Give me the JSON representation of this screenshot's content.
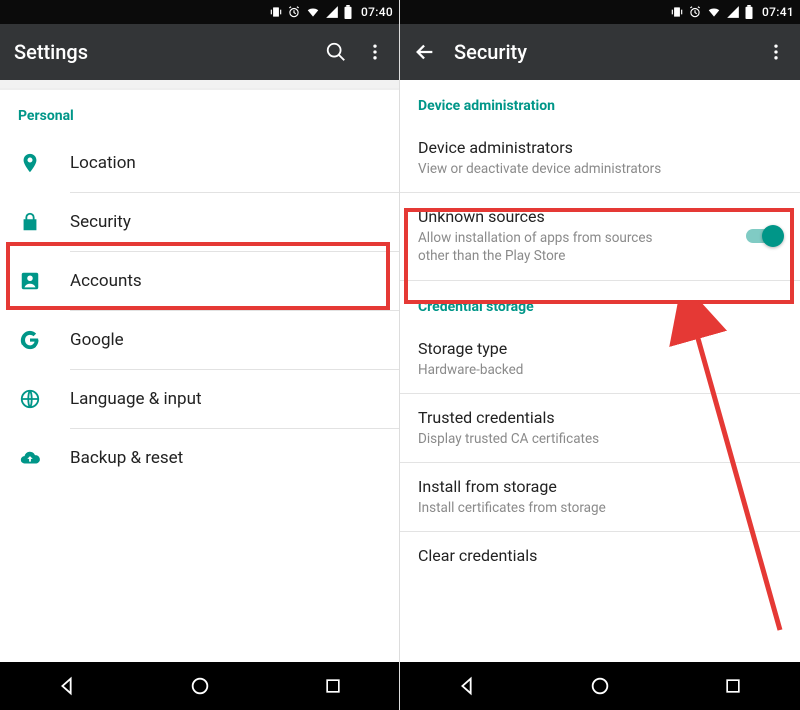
{
  "left": {
    "status_time": "07:40",
    "app_title": "Settings",
    "section": "Personal",
    "items": [
      {
        "label": "Location"
      },
      {
        "label": "Security"
      },
      {
        "label": "Accounts"
      },
      {
        "label": "Google"
      },
      {
        "label": "Language & input"
      },
      {
        "label": "Backup & reset"
      }
    ]
  },
  "right": {
    "status_time": "07:41",
    "app_title": "Security",
    "sections": {
      "device_admin": {
        "header": "Device administration",
        "items": [
          {
            "title": "Device administrators",
            "sub": "View or deactivate device administrators"
          },
          {
            "title": "Unknown sources",
            "sub": "Allow installation of apps from sources other than the Play Store",
            "toggle": true
          }
        ]
      },
      "cred_storage": {
        "header": "Credential storage",
        "items": [
          {
            "title": "Storage type",
            "sub": "Hardware-backed"
          },
          {
            "title": "Trusted credentials",
            "sub": "Display trusted CA certificates"
          },
          {
            "title": "Install from storage",
            "sub": "Install certificates from storage"
          },
          {
            "title": "Clear credentials",
            "sub": ""
          }
        ]
      }
    }
  },
  "accent": "#009688",
  "highlight_color": "#e53935"
}
